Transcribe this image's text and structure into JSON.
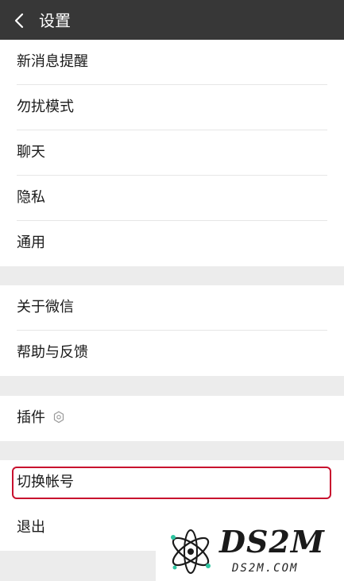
{
  "header": {
    "title": "设置",
    "back_icon": "chevron-left-icon"
  },
  "groups": [
    {
      "items": [
        {
          "label": "新消息提醒"
        },
        {
          "label": "勿扰模式"
        },
        {
          "label": "聊天"
        },
        {
          "label": "隐私"
        },
        {
          "label": "通用"
        }
      ]
    },
    {
      "items": [
        {
          "label": "关于微信"
        },
        {
          "label": "帮助与反馈"
        }
      ]
    },
    {
      "items": [
        {
          "label": "插件",
          "icon": "plugin-icon"
        }
      ]
    },
    {
      "items": [
        {
          "label": "切换帐号",
          "highlighted": true
        },
        {
          "label": "退出"
        }
      ]
    }
  ],
  "watermark": {
    "brand": "DS2M",
    "url": "DS2M.COM",
    "logo_icon": "atom-logo-icon"
  },
  "colors": {
    "header_bg": "#373737",
    "page_bg": "#ececec",
    "highlight_border": "#c8102e",
    "logo_accent": "#2ec4a0"
  }
}
